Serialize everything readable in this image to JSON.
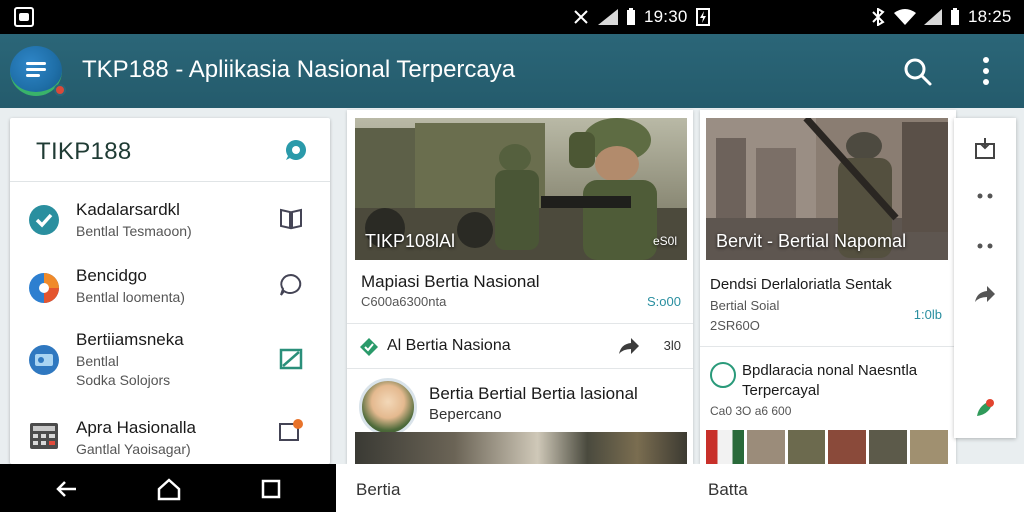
{
  "status_bar": {
    "time_left": "19:30",
    "time_right": "18:25"
  },
  "app_bar": {
    "title": "TKP188 - Apliikasia Nasional Terpercaya",
    "icons": [
      "menu-icon",
      "search-icon",
      "more-vert-icon"
    ]
  },
  "sidebar": {
    "title": "TIKP188",
    "items": [
      {
        "title": "Kadalarsardkl",
        "subtitle": "Bentlal Tesmaoon)",
        "icon": "verified-chat-icon",
        "action_icon": "book-icon"
      },
      {
        "title": "Bencidgo",
        "subtitle": "Bentlal loomenta)",
        "icon": "color-wheel-icon",
        "action_icon": "chat-bubble-icon"
      },
      {
        "title": "Bertiiamsneka",
        "subtitle": "Bentlal",
        "subtitle2": "Sodka Solojors",
        "icon": "card-icon",
        "action_icon": "image-frame-icon"
      },
      {
        "title": "Apra Hasionalla",
        "subtitle": "Gantlal Yaoisagar)",
        "icon": "calculator-icon",
        "action_icon": "notification-badge-icon"
      }
    ]
  },
  "middle_card": {
    "image_caption": "TIKP108lAl",
    "image_tag": "eS0l",
    "headline": "Mapiasi Bertia Nasional",
    "subline": "C600a6300nta",
    "value": "S:o00",
    "row_label": "Al Bertia Nasiona",
    "row_count": "3l0",
    "article_title": "Bertia Bertial Bertia lasional",
    "article_sub": "Bepercano"
  },
  "right_card": {
    "image_caption": "Bervit - Bertial Napomal",
    "headline": "Dendsi Derlaloriatla Sentak",
    "sub1": "Bertial Soial",
    "sub2": "2SR60O",
    "value": "1:0lb",
    "item_title": "Bpdlaracia nonal Naesntla",
    "item_sub": "Terpercayal",
    "item_meta": "Ca0 3O a6 600"
  },
  "bottom": {
    "left_label": "Bertia",
    "right_label": "Batta"
  },
  "colors": {
    "app_bar": "#2b6678",
    "accent": "#2a8fa0",
    "status": "#000000"
  }
}
